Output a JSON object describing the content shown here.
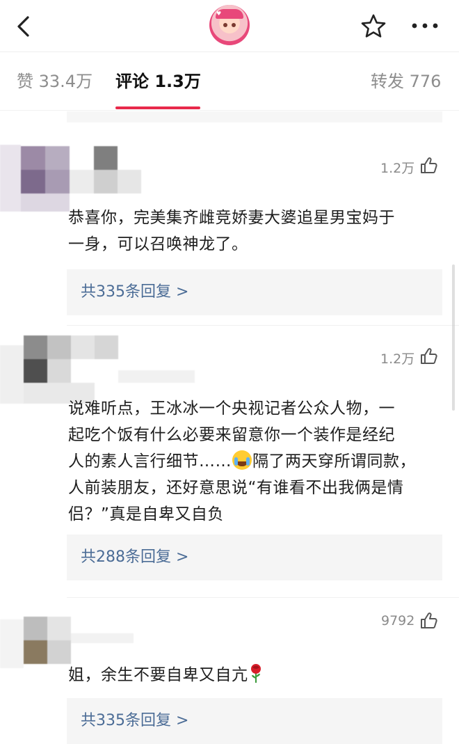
{
  "header": {
    "back_icon": "chevron-left-icon",
    "avatar_icon": "cartoon-baby-avatar",
    "star_icon": "star-outline-icon",
    "more_icon": "more-dots-icon"
  },
  "tabs": [
    {
      "label": "赞 33.4万",
      "active": false
    },
    {
      "label": "评论 1.3万",
      "active": true
    },
    {
      "label": "转发 776",
      "active": false
    }
  ],
  "accent_color": "#e8294a",
  "link_color": "#4b6c96",
  "comments": [
    {
      "likes": "1.2万",
      "text_lines": [
        "恭喜你，完美集齐雌竞娇妻大婆追星男宝妈于",
        "一身，可以召唤神龙了。"
      ],
      "reply_label": "共335条回复 >"
    },
    {
      "likes": "1.2万",
      "text_lines": [
        "说难听点，王冰冰一个央视记者公众人物，一",
        "起吃个饭有什么必要来留意你一个装作是经纪",
        "人的素人言行细节……",
        "隔了两天穿所谓同款，",
        "人前装朋友，还好意思说“有谁看不出我俩是情",
        "侣？”真是自卑又自负"
      ],
      "reply_label": "共288条回复 >"
    },
    {
      "likes": "9792",
      "text_lines": [
        "姐，余生不要自卑又自亢"
      ],
      "reply_label": "共335条回复 >"
    }
  ]
}
